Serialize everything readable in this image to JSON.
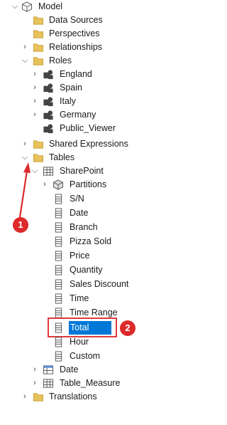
{
  "tree": {
    "model": "Model",
    "data_sources": "Data Sources",
    "perspectives": "Perspectives",
    "relationships": "Relationships",
    "roles": "Roles",
    "role_england": "England",
    "role_spain": "Spain",
    "role_italy": "Italy",
    "role_germany": "Germany",
    "role_public_viewer": "Public_Viewer",
    "shared_expressions": "Shared Expressions",
    "tables": "Tables",
    "table_sharepoint": "SharePoint",
    "partitions": "Partitions",
    "col_sn": "S/N",
    "col_date": "Date",
    "col_branch": "Branch",
    "col_pizza_sold": "Pizza Sold",
    "col_price": "Price",
    "col_quantity": "Quantity",
    "col_sales_discount": "Sales Discount",
    "col_time": "Time",
    "col_time_range": "Time Range",
    "col_total": "Total",
    "col_hour": "Hour",
    "col_custom": "Custom",
    "table_date": "Date",
    "table_measure": "Table_Measure",
    "translations": "Translations"
  },
  "annotations": {
    "marker_1": "1",
    "marker_2": "2"
  },
  "colors": {
    "selection": "#0078d7",
    "annotation": "#dd2a2a",
    "folder": "#e8c25a"
  }
}
